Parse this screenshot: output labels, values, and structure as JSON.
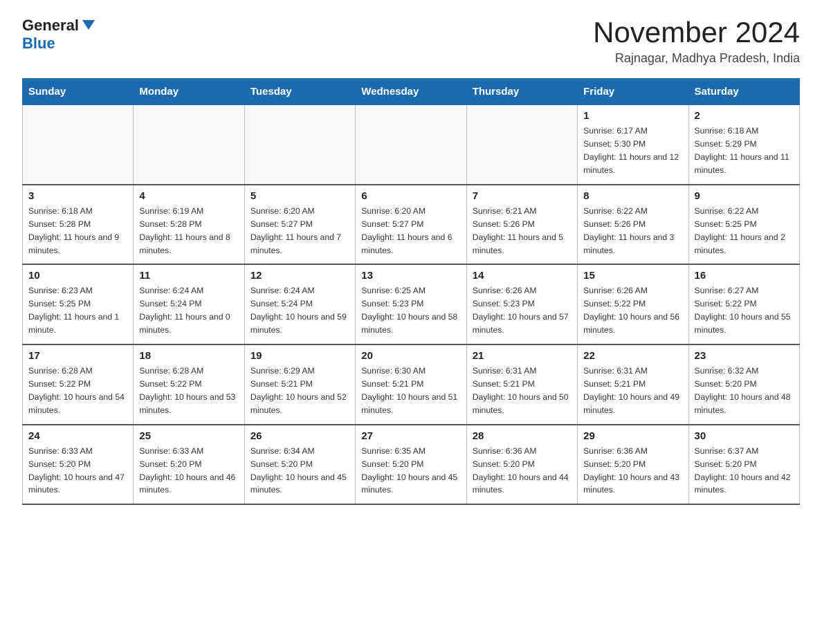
{
  "header": {
    "logo_general": "General",
    "logo_blue": "Blue",
    "month_title": "November 2024",
    "location": "Rajnagar, Madhya Pradesh, India"
  },
  "weekdays": [
    "Sunday",
    "Monday",
    "Tuesday",
    "Wednesday",
    "Thursday",
    "Friday",
    "Saturday"
  ],
  "weeks": [
    [
      {
        "day": "",
        "info": ""
      },
      {
        "day": "",
        "info": ""
      },
      {
        "day": "",
        "info": ""
      },
      {
        "day": "",
        "info": ""
      },
      {
        "day": "",
        "info": ""
      },
      {
        "day": "1",
        "info": "Sunrise: 6:17 AM\nSunset: 5:30 PM\nDaylight: 11 hours and 12 minutes."
      },
      {
        "day": "2",
        "info": "Sunrise: 6:18 AM\nSunset: 5:29 PM\nDaylight: 11 hours and 11 minutes."
      }
    ],
    [
      {
        "day": "3",
        "info": "Sunrise: 6:18 AM\nSunset: 5:28 PM\nDaylight: 11 hours and 9 minutes."
      },
      {
        "day": "4",
        "info": "Sunrise: 6:19 AM\nSunset: 5:28 PM\nDaylight: 11 hours and 8 minutes."
      },
      {
        "day": "5",
        "info": "Sunrise: 6:20 AM\nSunset: 5:27 PM\nDaylight: 11 hours and 7 minutes."
      },
      {
        "day": "6",
        "info": "Sunrise: 6:20 AM\nSunset: 5:27 PM\nDaylight: 11 hours and 6 minutes."
      },
      {
        "day": "7",
        "info": "Sunrise: 6:21 AM\nSunset: 5:26 PM\nDaylight: 11 hours and 5 minutes."
      },
      {
        "day": "8",
        "info": "Sunrise: 6:22 AM\nSunset: 5:26 PM\nDaylight: 11 hours and 3 minutes."
      },
      {
        "day": "9",
        "info": "Sunrise: 6:22 AM\nSunset: 5:25 PM\nDaylight: 11 hours and 2 minutes."
      }
    ],
    [
      {
        "day": "10",
        "info": "Sunrise: 6:23 AM\nSunset: 5:25 PM\nDaylight: 11 hours and 1 minute."
      },
      {
        "day": "11",
        "info": "Sunrise: 6:24 AM\nSunset: 5:24 PM\nDaylight: 11 hours and 0 minutes."
      },
      {
        "day": "12",
        "info": "Sunrise: 6:24 AM\nSunset: 5:24 PM\nDaylight: 10 hours and 59 minutes."
      },
      {
        "day": "13",
        "info": "Sunrise: 6:25 AM\nSunset: 5:23 PM\nDaylight: 10 hours and 58 minutes."
      },
      {
        "day": "14",
        "info": "Sunrise: 6:26 AM\nSunset: 5:23 PM\nDaylight: 10 hours and 57 minutes."
      },
      {
        "day": "15",
        "info": "Sunrise: 6:26 AM\nSunset: 5:22 PM\nDaylight: 10 hours and 56 minutes."
      },
      {
        "day": "16",
        "info": "Sunrise: 6:27 AM\nSunset: 5:22 PM\nDaylight: 10 hours and 55 minutes."
      }
    ],
    [
      {
        "day": "17",
        "info": "Sunrise: 6:28 AM\nSunset: 5:22 PM\nDaylight: 10 hours and 54 minutes."
      },
      {
        "day": "18",
        "info": "Sunrise: 6:28 AM\nSunset: 5:22 PM\nDaylight: 10 hours and 53 minutes."
      },
      {
        "day": "19",
        "info": "Sunrise: 6:29 AM\nSunset: 5:21 PM\nDaylight: 10 hours and 52 minutes."
      },
      {
        "day": "20",
        "info": "Sunrise: 6:30 AM\nSunset: 5:21 PM\nDaylight: 10 hours and 51 minutes."
      },
      {
        "day": "21",
        "info": "Sunrise: 6:31 AM\nSunset: 5:21 PM\nDaylight: 10 hours and 50 minutes."
      },
      {
        "day": "22",
        "info": "Sunrise: 6:31 AM\nSunset: 5:21 PM\nDaylight: 10 hours and 49 minutes."
      },
      {
        "day": "23",
        "info": "Sunrise: 6:32 AM\nSunset: 5:20 PM\nDaylight: 10 hours and 48 minutes."
      }
    ],
    [
      {
        "day": "24",
        "info": "Sunrise: 6:33 AM\nSunset: 5:20 PM\nDaylight: 10 hours and 47 minutes."
      },
      {
        "day": "25",
        "info": "Sunrise: 6:33 AM\nSunset: 5:20 PM\nDaylight: 10 hours and 46 minutes."
      },
      {
        "day": "26",
        "info": "Sunrise: 6:34 AM\nSunset: 5:20 PM\nDaylight: 10 hours and 45 minutes."
      },
      {
        "day": "27",
        "info": "Sunrise: 6:35 AM\nSunset: 5:20 PM\nDaylight: 10 hours and 45 minutes."
      },
      {
        "day": "28",
        "info": "Sunrise: 6:36 AM\nSunset: 5:20 PM\nDaylight: 10 hours and 44 minutes."
      },
      {
        "day": "29",
        "info": "Sunrise: 6:36 AM\nSunset: 5:20 PM\nDaylight: 10 hours and 43 minutes."
      },
      {
        "day": "30",
        "info": "Sunrise: 6:37 AM\nSunset: 5:20 PM\nDaylight: 10 hours and 42 minutes."
      }
    ]
  ]
}
